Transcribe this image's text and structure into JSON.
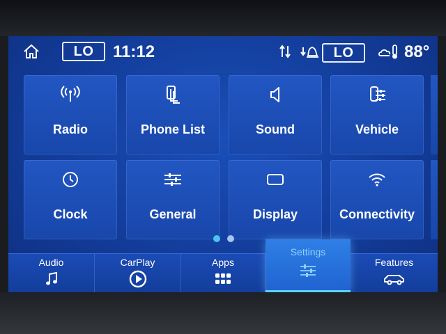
{
  "status_bar": {
    "left_temp_setting": "LO",
    "time": "11:12",
    "right_temp_setting": "LO",
    "outside_temp": "88°",
    "icons": [
      "home-icon",
      "data-arrows-icon",
      "alert-bell-icon",
      "weather-thermometer-icon"
    ]
  },
  "tiles": [
    {
      "label": "Radio",
      "icon": "radio-antenna-icon"
    },
    {
      "label": "Phone List",
      "icon": "phone-list-icon"
    },
    {
      "label": "Sound",
      "icon": "speaker-icon"
    },
    {
      "label": "Vehicle",
      "icon": "vehicle-settings-icon"
    },
    {
      "label": "Clock",
      "icon": "clock-icon"
    },
    {
      "label": "General",
      "icon": "sliders-icon"
    },
    {
      "label": "Display",
      "icon": "display-icon"
    },
    {
      "label": "Connectivity",
      "icon": "wifi-icon"
    }
  ],
  "pagination": {
    "pages": 2,
    "current": 1
  },
  "bottom_nav": {
    "items": [
      {
        "label": "Audio",
        "icon": "music-note-icon"
      },
      {
        "label": "CarPlay",
        "icon": "carplay-icon"
      },
      {
        "label": "Apps",
        "icon": "apps-grid-icon"
      },
      {
        "label": "Settings",
        "icon": "settings-sliders-icon"
      },
      {
        "label": "Features",
        "icon": "car-icon"
      }
    ],
    "active": "Settings"
  },
  "colors": {
    "screen_bg": "#1440a0",
    "tile_bg": "#1f50bb",
    "active_tab": "#2f7fe6",
    "active_label": "#8fd2ff",
    "dot_active": "#4ec3f0"
  }
}
